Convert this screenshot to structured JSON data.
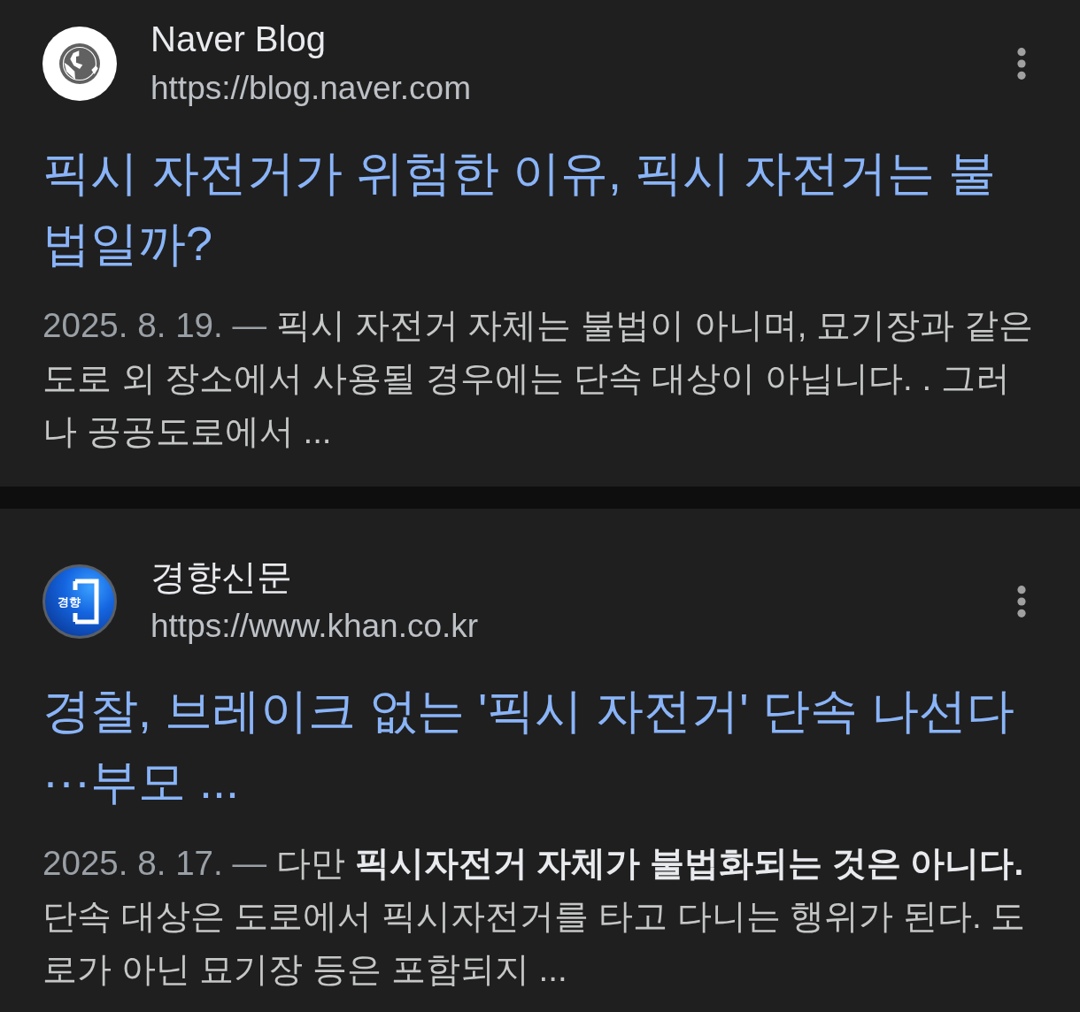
{
  "results": [
    {
      "kind": "globe",
      "site_name": "Naver Blog",
      "url": "https://blog.naver.com",
      "title": "픽시 자전거가 위험한 이유, 픽시 자전거는 불법일까?",
      "date": "2025. 8. 19. —",
      "snippet": "픽시 자전거 자체는 불법이 아니며, 묘기장과 같은 도로 외 장소에서 사용될 경우에는 단속 대상이 아닙니다. . 그러나 공공도로에서 ..."
    },
    {
      "kind": "logo",
      "logo_text": "경향",
      "site_name": "경향신문",
      "url": "https://www.khan.co.kr",
      "title": "경찰, 브레이크 없는 '픽시 자전거' 단속 나선다···부모 ...",
      "date": "2025. 8. 17. —",
      "snippet": "다만 **픽시자전거 자체가 불법화되는 것은 아니다.** 단속 대상은 도로에서 픽시자전거를 타고 다니는 행위가 된다. 도로가 아닌 묘기장 등은 포함되지 ..."
    }
  ]
}
